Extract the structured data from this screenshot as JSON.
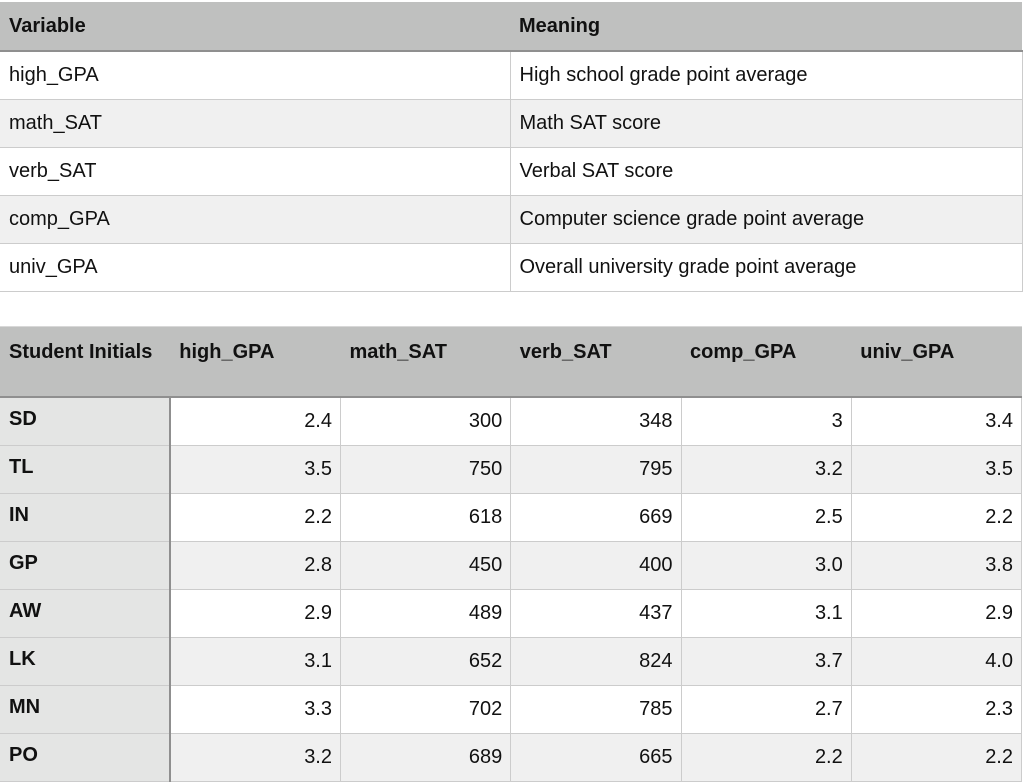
{
  "variables_table": {
    "headers": [
      "Variable",
      "Meaning"
    ],
    "rows": [
      {
        "variable": "high_GPA",
        "meaning": "High school grade point average"
      },
      {
        "variable": "math_SAT",
        "meaning": "Math SAT score"
      },
      {
        "variable": "verb_SAT",
        "meaning": "Verbal SAT score"
      },
      {
        "variable": "comp_GPA",
        "meaning": "Computer science grade point average"
      },
      {
        "variable": "univ_GPA",
        "meaning": "Overall university grade point average"
      }
    ]
  },
  "students_table": {
    "headers": [
      "Student Initials",
      "high_GPA",
      "math_SAT",
      "verb_SAT",
      "comp_GPA",
      "univ_GPA"
    ],
    "rows": [
      {
        "initials": "SD",
        "values": [
          "2.4",
          "300",
          "348",
          "3",
          "3.4"
        ]
      },
      {
        "initials": "TL",
        "values": [
          "3.5",
          "750",
          "795",
          "3.2",
          "3.5"
        ]
      },
      {
        "initials": "IN",
        "values": [
          "2.2",
          "618",
          "669",
          "2.5",
          "2.2"
        ]
      },
      {
        "initials": "GP",
        "values": [
          "2.8",
          "450",
          "400",
          "3.0",
          "3.8"
        ]
      },
      {
        "initials": "AW",
        "values": [
          "2.9",
          "489",
          "437",
          "3.1",
          "2.9"
        ]
      },
      {
        "initials": "LK",
        "values": [
          "3.1",
          "652",
          "824",
          "3.7",
          "4.0"
        ]
      },
      {
        "initials": "MN",
        "values": [
          "3.3",
          "702",
          "785",
          "2.7",
          "2.3"
        ]
      },
      {
        "initials": "PO",
        "values": [
          "3.2",
          "689",
          "665",
          "2.2",
          "2.2"
        ]
      }
    ]
  },
  "colors": {
    "header_bg": "#bfc0bf",
    "row_alt_bg": "#f0f0f0",
    "rowhead_bg": "#e4e5e4",
    "border": "#cccccc"
  }
}
